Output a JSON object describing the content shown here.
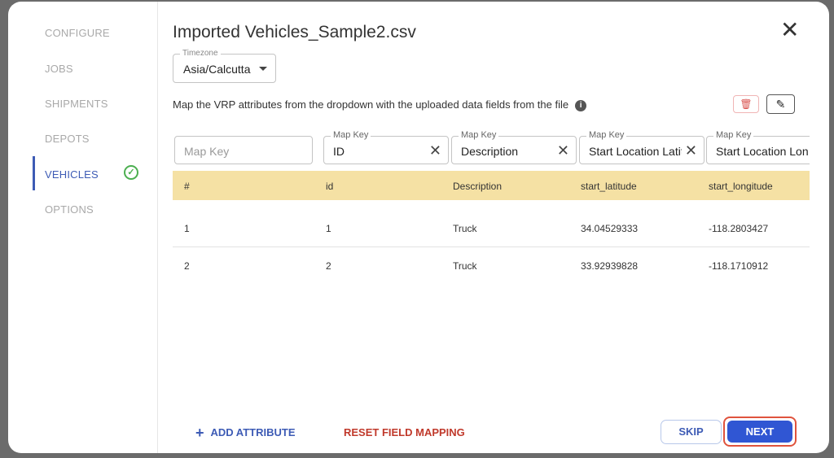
{
  "sidebar": {
    "items": [
      {
        "label": "CONFIGURE"
      },
      {
        "label": "JOBS"
      },
      {
        "label": "SHIPMENTS"
      },
      {
        "label": "DEPOTS"
      },
      {
        "label": "VEHICLES",
        "active": true,
        "completed": true
      },
      {
        "label": "OPTIONS"
      }
    ]
  },
  "header": {
    "title": "Imported Vehicles_Sample2.csv",
    "close_icon": "close-icon"
  },
  "timezone": {
    "label": "Timezone",
    "value": "Asia/Calcutta"
  },
  "instructions": "Map the VRP attributes from the dropdown with the uploaded data fields from the file",
  "map_keys": [
    {
      "label": "",
      "value": "",
      "placeholder": "Map Key"
    },
    {
      "label": "Map Key",
      "value": "ID"
    },
    {
      "label": "Map Key",
      "value": "Description"
    },
    {
      "label": "Map Key",
      "value": "Start Location Latitude"
    },
    {
      "label": "Map Key",
      "value": "Start Location Longitude"
    }
  ],
  "table": {
    "headers": [
      "#",
      "id",
      "Description",
      "start_latitude",
      "start_longitude"
    ],
    "rows": [
      [
        "1",
        "1",
        "Truck",
        "34.04529333",
        "-118.2803427"
      ],
      [
        "2",
        "2",
        "Truck",
        "33.92939828",
        "-118.1710912"
      ]
    ]
  },
  "footer": {
    "add_attribute": "ADD ATTRIBUTE",
    "reset": "RESET FIELD MAPPING",
    "skip": "SKIP",
    "next": "NEXT"
  },
  "colors": {
    "accent": "#3056d3",
    "header_bg": "#f5e1a4",
    "danger": "#c0392b",
    "success": "#4caf50"
  }
}
